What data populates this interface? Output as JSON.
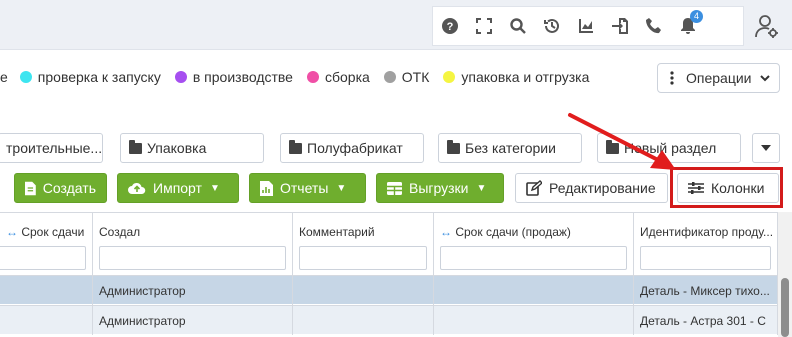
{
  "topbar": {
    "icons": [
      "help-icon",
      "fullscreen-icon",
      "search-icon",
      "history-icon",
      "chart-icon",
      "import-icon",
      "phone-icon",
      "bell-icon"
    ],
    "bell_badge": "4",
    "user_icon": "user-settings-icon"
  },
  "legend": [
    {
      "label": "е",
      "color": ""
    },
    {
      "label": "проверка к запуску",
      "color": "#3de5f0"
    },
    {
      "label": "в производстве",
      "color": "#a64ff0"
    },
    {
      "label": "сборка",
      "color": "#f04fa6"
    },
    {
      "label": "ОТК",
      "color": "#a0a0a0"
    },
    {
      "label": "упаковка и отгрузка",
      "color": "#f5f542"
    }
  ],
  "operations_label": "Операции",
  "categories": [
    {
      "label": "троительные..."
    },
    {
      "label": "Упаковка"
    },
    {
      "label": "Полуфабрикат"
    },
    {
      "label": "Без категории"
    },
    {
      "label": "Новый раздел"
    }
  ],
  "toolbar": {
    "create": "Создать",
    "import": "Импорт",
    "reports": "Отчеты",
    "exports": "Выгрузки",
    "edit": "Редактирование",
    "columns": "Колонки"
  },
  "colors": {
    "green": "#6fae2e",
    "highlight": "#d31b1b",
    "selected_row": "#c6d6e6",
    "row_alt": "#eaeff5"
  },
  "table": {
    "headers": [
      "Срок сдачи",
      "Создал",
      "Комментарий",
      "Срок сдачи (продаж)",
      "Идентификатор проду..."
    ],
    "rows": [
      [
        "",
        "Администратор",
        "",
        "",
        "Деталь - Миксер тихо..."
      ],
      [
        "",
        "Администратор",
        "",
        "",
        "Деталь - Астра 301 - С"
      ]
    ]
  }
}
